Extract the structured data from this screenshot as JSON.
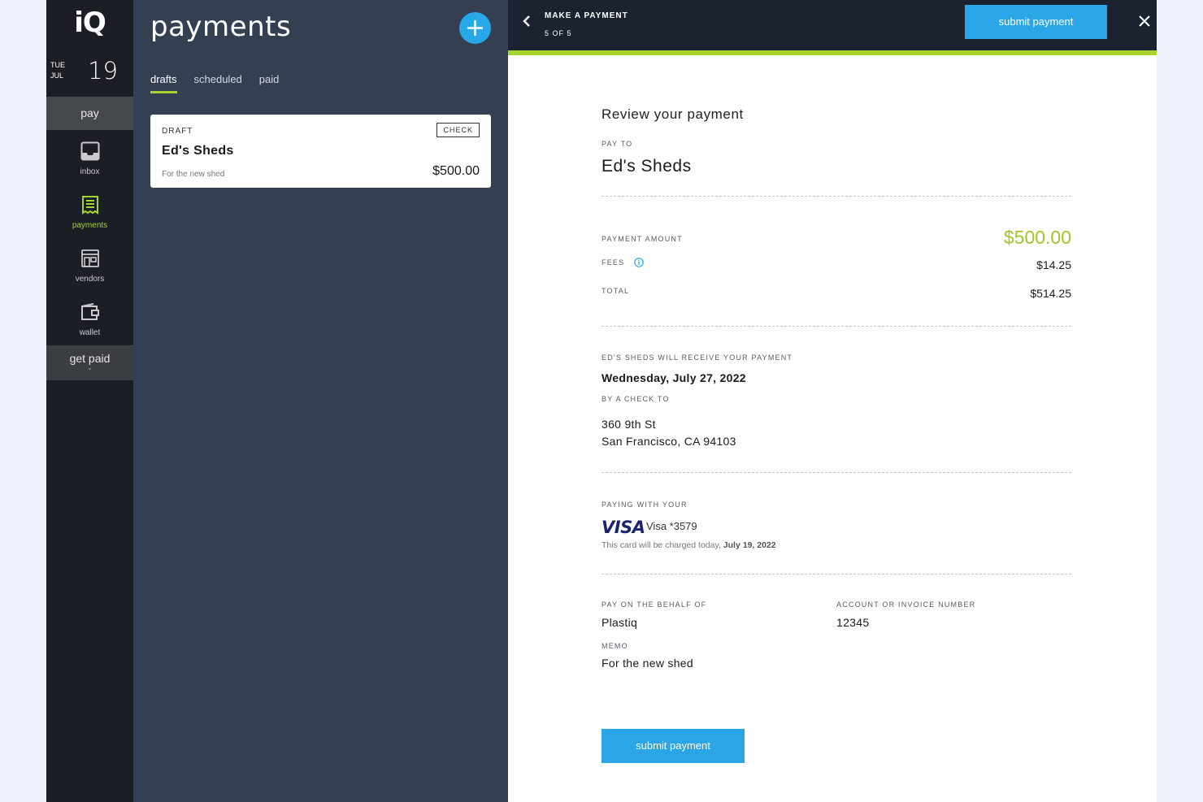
{
  "nav": {
    "logo": "iQ",
    "date": {
      "dow": "TUE",
      "month": "JUL",
      "day": "19"
    },
    "pay_section": "pay",
    "items": [
      {
        "label": "inbox",
        "icon": "inbox-icon"
      },
      {
        "label": "payments",
        "icon": "receipt-icon",
        "active": true
      },
      {
        "label": "vendors",
        "icon": "storefront-icon"
      },
      {
        "label": "wallet",
        "icon": "wallet-icon"
      }
    ],
    "get_paid_section": "get paid",
    "accent_color": "#a7d32f"
  },
  "list": {
    "title": "payments",
    "tabs": [
      {
        "label": "drafts",
        "active": true
      },
      {
        "label": "scheduled"
      },
      {
        "label": "paid"
      }
    ],
    "cards": [
      {
        "status": "DRAFT",
        "method": "CHECK",
        "name": "Ed's Sheds",
        "memo": "For the new shed",
        "amount": "$500.00"
      }
    ]
  },
  "detail": {
    "header": {
      "title": "MAKE A PAYMENT",
      "step": "5 OF 5",
      "submit_label": "submit payment"
    },
    "heading": "Review your payment",
    "pay_to_label": "PAY TO",
    "pay_to": "Ed's Sheds",
    "payment_amount_label": "PAYMENT AMOUNT",
    "payment_amount": "$500.00",
    "fees_label": "FEES",
    "fees": "$14.25",
    "total_label": "TOTAL",
    "total": "$514.25",
    "receive_label": "ED'S SHEDS WILL RECEIVE YOUR PAYMENT",
    "receive_date": "Wednesday, July 27, 2022",
    "method_label": "BY A CHECK TO",
    "address_line1": "360 9th St",
    "address_line2": "San Francisco, CA 94103",
    "paying_with_label": "PAYING WITH YOUR",
    "card_brand": "VISA",
    "card_desc": "Visa *3579",
    "charge_note_prefix": "This card will be charged today, ",
    "charge_note_date": "July 19, 2022",
    "behalf_label": "PAY ON THE BEHALF OF",
    "behalf": "Plastiq",
    "account_label": "ACCOUNT OR INVOICE NUMBER",
    "account": "12345",
    "memo_label": "MEMO",
    "memo": "For the new shed",
    "submit_label": "submit payment",
    "amount_color": "#9fc625",
    "button_color": "#2aa5e5"
  }
}
